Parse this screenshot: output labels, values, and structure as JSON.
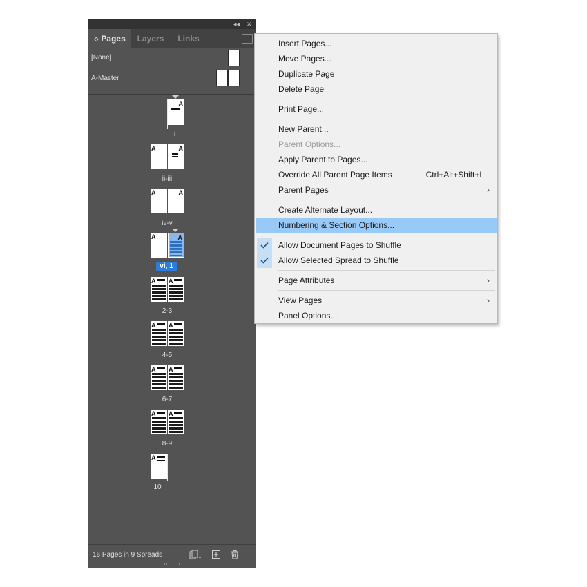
{
  "panel": {
    "collapse_icon": "double-chevron-left-icon",
    "close_icon": "close-icon",
    "tabs": [
      {
        "label": "Pages",
        "active": true
      },
      {
        "label": "Layers",
        "active": false
      },
      {
        "label": "Links",
        "active": false
      }
    ],
    "masters": [
      {
        "label": "[None]"
      },
      {
        "label": "A-Master"
      }
    ],
    "spreads": [
      {
        "label": "i",
        "master_marks": [
          "A"
        ]
      },
      {
        "label": "ii-iii",
        "master_marks": [
          "A",
          "A"
        ]
      },
      {
        "label": "iv-v",
        "master_marks": [
          "A",
          "A"
        ]
      },
      {
        "label": "vi, 1",
        "master_marks": [
          "A",
          "A"
        ],
        "selected": true
      },
      {
        "label": "2-3",
        "master_marks": [
          "A",
          "A"
        ]
      },
      {
        "label": "4-5",
        "master_marks": [
          "A",
          "A"
        ]
      },
      {
        "label": "6-7",
        "master_marks": [
          "A",
          "A"
        ]
      },
      {
        "label": "8-9",
        "master_marks": [
          "A",
          "A"
        ]
      },
      {
        "label": "10",
        "master_marks": [
          "A"
        ]
      }
    ],
    "footer": {
      "status": "16 Pages in 9 Spreads",
      "icons": [
        "edit-page-size-icon",
        "new-page-icon",
        "trash-icon"
      ]
    }
  },
  "menu": {
    "items": [
      {
        "label": "Insert Pages..."
      },
      {
        "label": "Move Pages..."
      },
      {
        "label": "Duplicate Page"
      },
      {
        "label": "Delete Page"
      },
      {
        "label": "Print Page..."
      },
      {
        "label": "New Parent..."
      },
      {
        "label": "Parent Options...",
        "disabled": true
      },
      {
        "label": "Apply Parent to Pages..."
      },
      {
        "label": "Override All Parent Page Items",
        "shortcut": "Ctrl+Alt+Shift+L"
      },
      {
        "label": "Parent Pages",
        "submenu": true
      },
      {
        "label": "Create Alternate Layout..."
      },
      {
        "label": "Numbering & Section Options...",
        "highlighted": true
      },
      {
        "label": "Allow Document Pages to Shuffle",
        "checked": true
      },
      {
        "label": "Allow Selected Spread to Shuffle",
        "checked": true
      },
      {
        "label": "Page Attributes",
        "submenu": true
      },
      {
        "label": "View Pages",
        "submenu": true
      },
      {
        "label": "Panel Options..."
      }
    ]
  },
  "colors": {
    "panel_bg": "#535353",
    "selection": "#2c7cd8",
    "menu_highlight": "#99c9f7"
  }
}
